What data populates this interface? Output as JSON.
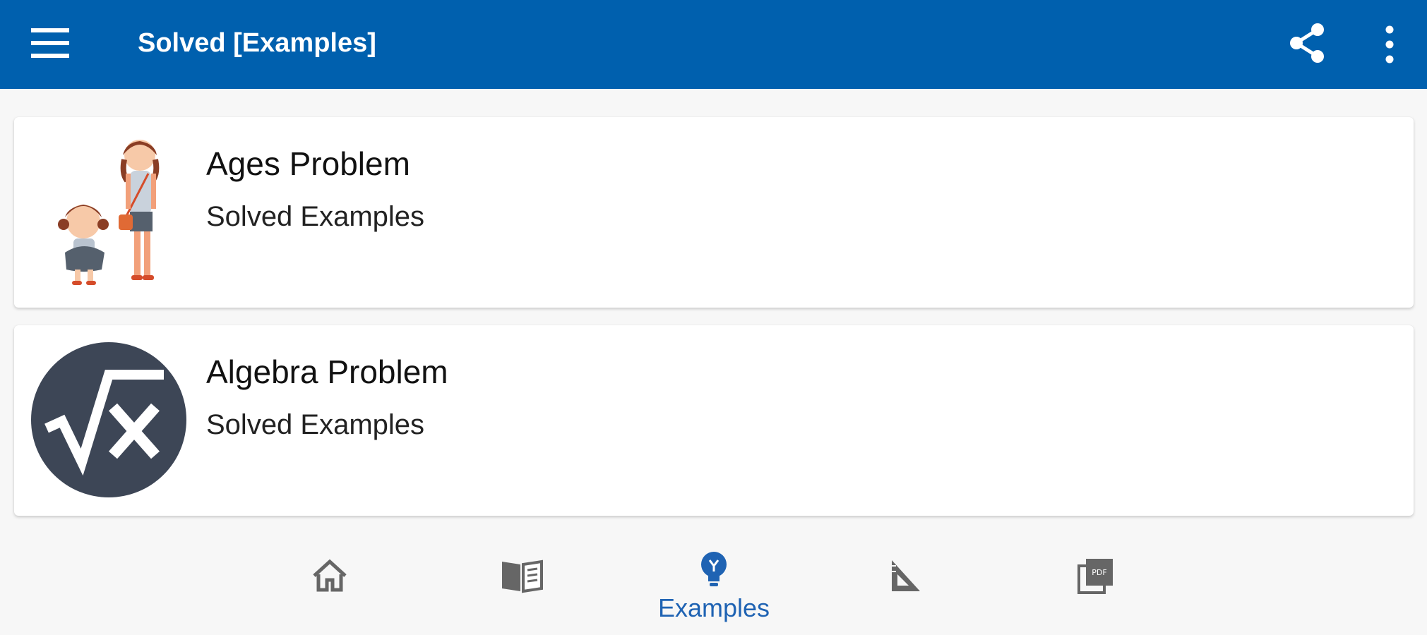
{
  "appbar": {
    "title": "Solved [Examples]",
    "icons": {
      "menu": "hamburger-menu-icon",
      "share": "share-icon",
      "more": "more-vert-icon"
    },
    "color": "#0060ae"
  },
  "cards": [
    {
      "title": "Ages Problem",
      "subtitle": "Solved Examples",
      "icon": "two-girls-illustration"
    },
    {
      "title": "Algebra Problem",
      "subtitle": "Solved Examples",
      "icon": "square-root-x-icon"
    }
  ],
  "bottom_nav": {
    "items": [
      {
        "icon": "home-icon",
        "label": ""
      },
      {
        "icon": "book-icon",
        "label": ""
      },
      {
        "icon": "lightbulb-icon",
        "label": "Examples",
        "selected": true
      },
      {
        "icon": "set-square-icon",
        "label": ""
      },
      {
        "icon": "pdf-icon",
        "label": ""
      }
    ],
    "accent": "#1f63b3"
  }
}
